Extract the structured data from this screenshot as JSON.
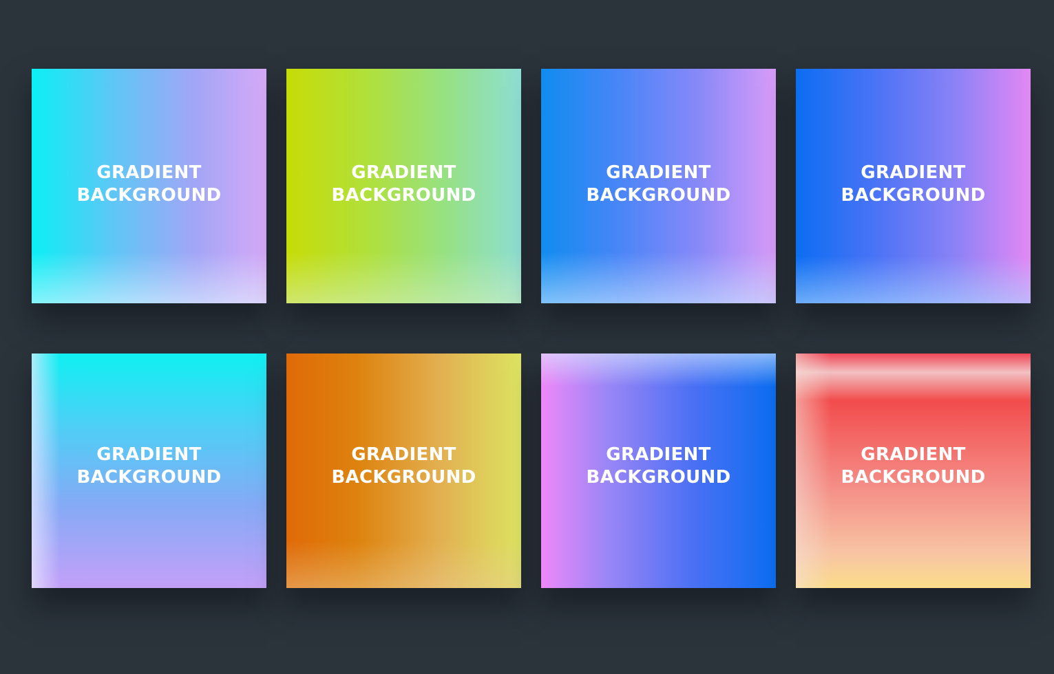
{
  "tiles": [
    {
      "line1": "GRADIENT",
      "line2": "BACKGROUND",
      "colors": [
        "#0bf0f4",
        "#a3a5f6",
        "#d6aaf8"
      ]
    },
    {
      "line1": "GRADIENT",
      "line2": "BACKGROUND",
      "colors": [
        "#c7dc06",
        "#96e184",
        "#8edfd4"
      ]
    },
    {
      "line1": "GRADIENT",
      "line2": "BACKGROUND",
      "colors": [
        "#108cf0",
        "#8a89f8",
        "#d99cf8"
      ]
    },
    {
      "line1": "GRADIENT",
      "line2": "BACKGROUND",
      "colors": [
        "#0c6df2",
        "#8b82f6",
        "#e388f4"
      ]
    },
    {
      "line1": "GRADIENT",
      "line2": "BACKGROUND",
      "colors": [
        "#0ff0f2",
        "#86aaf6",
        "#c3a0f8"
      ]
    },
    {
      "line1": "GRADIENT",
      "line2": "BACKGROUND",
      "colors": [
        "#e06a08",
        "#e2af50",
        "#dde462"
      ]
    },
    {
      "line1": "GRADIENT",
      "line2": "BACKGROUND",
      "colors": [
        "#ee88f8",
        "#4a70f4",
        "#0c6ef0"
      ]
    },
    {
      "line1": "GRADIENT",
      "line2": "BACKGROUND",
      "colors": [
        "#f24c4c",
        "#f48a84",
        "#fadc8a"
      ]
    }
  ],
  "background_color": "#2b333b"
}
